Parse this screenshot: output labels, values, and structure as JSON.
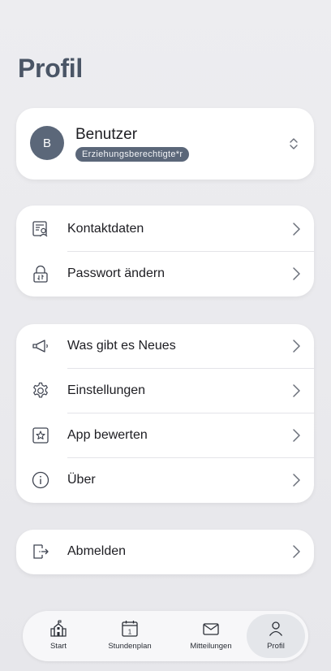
{
  "page": {
    "title": "Profil"
  },
  "user": {
    "avatar_initial": "B",
    "name": "Benutzer",
    "role": "Erziehungsberechtigte*r"
  },
  "account_menu": [
    {
      "label": "Kontaktdaten",
      "icon": "contact-card-icon"
    },
    {
      "label": "Passwort ändern",
      "icon": "lock-icon"
    }
  ],
  "general_menu": [
    {
      "label": "Was gibt es Neues",
      "icon": "megaphone-icon"
    },
    {
      "label": "Einstellungen",
      "icon": "gear-icon"
    },
    {
      "label": "App bewerten",
      "icon": "star-icon"
    },
    {
      "label": "Über",
      "icon": "info-icon"
    }
  ],
  "logout": {
    "label": "Abmelden",
    "icon": "logout-icon"
  },
  "tabbar": {
    "active": "Profil",
    "tabs": [
      {
        "label": "Start",
        "icon": "school-icon"
      },
      {
        "label": "Stundenplan",
        "icon": "calendar-icon",
        "calendar_day": "1"
      },
      {
        "label": "Mitteilungen",
        "icon": "mail-icon"
      },
      {
        "label": "Profil",
        "icon": "person-icon"
      }
    ]
  },
  "colors": {
    "background": "#ebebee",
    "card": "#ffffff",
    "accent": "#5b6779",
    "title": "#4a5566",
    "active_tab": "#e4e6ea"
  }
}
